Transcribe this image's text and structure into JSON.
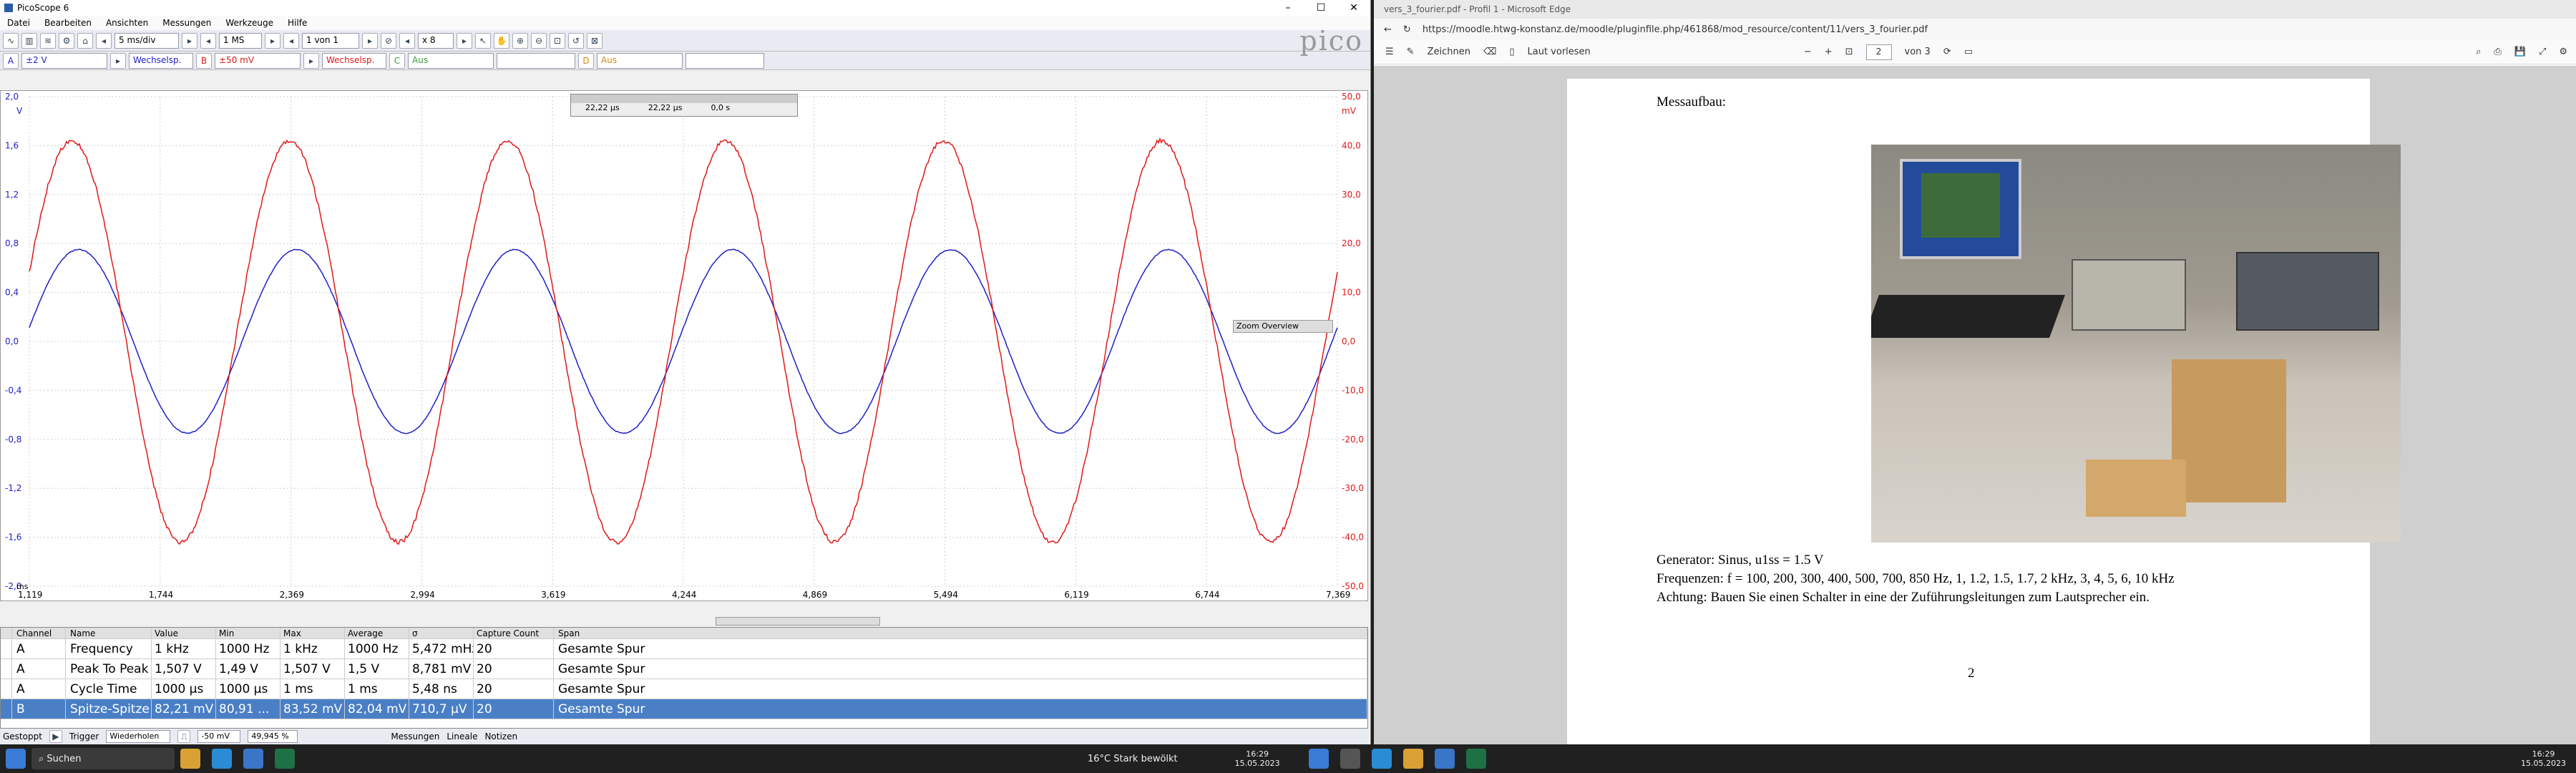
{
  "picoscope": {
    "title": "PicoScope 6",
    "menu": [
      "Datei",
      "Bearbeiten",
      "Ansichten",
      "Messungen",
      "Werkzeuge",
      "Hilfe"
    ],
    "timebase": "5 ms/div",
    "samples": "1 MS",
    "capture": "1 von 1",
    "zoom": "x 8",
    "chA_range": "±2 V",
    "chA_coupling": "Wechselsp.",
    "chB_range": "±50 mV",
    "chB_coupling": "Wechselsp.",
    "chC": "Aus",
    "chD": "Aus",
    "logo": "pico",
    "ruler_box": {
      "v1": "22,22 µs",
      "v2": "22,22 µs",
      "v3": "0,0 s"
    },
    "zoom_overview": "Zoom Overview",
    "left_axis": {
      "unit": "V",
      "ticks": [
        "2,0",
        "1,6",
        "1,2",
        "0,8",
        "0,4",
        "0,0",
        "-0,4",
        "-0,8",
        "-1,2",
        "-1,6",
        "-2,0"
      ]
    },
    "right_axis": {
      "unit": "mV",
      "ticks": [
        "50,0",
        "40,0",
        "30,0",
        "20,0",
        "10,0",
        "0,0",
        "-10,0",
        "-20,0",
        "-30,0",
        "-40,0",
        "-50,0"
      ]
    },
    "x_axis": {
      "unit": "ms",
      "ticks": [
        "1,119",
        "1,744",
        "2,369",
        "2,994",
        "3,619",
        "4,244",
        "4,869",
        "5,494",
        "6,119",
        "6,744",
        "7,369"
      ]
    },
    "colors": {
      "chA": "#2020c8",
      "chB": "#e01818"
    },
    "measurements": {
      "headers": [
        "Channel",
        "Name",
        "Value",
        "Min",
        "Max",
        "Average",
        "σ",
        "Capture Count",
        "Span"
      ],
      "rows": [
        [
          "A",
          "Frequency",
          "1 kHz",
          "1000 Hz",
          "1 kHz",
          "1000 Hz",
          "5,472 mHz",
          "20",
          "Gesamte Spur"
        ],
        [
          "A",
          "Peak To Peak",
          "1,507 V",
          "1,49 V",
          "1,507 V",
          "1,5 V",
          "8,781 mV",
          "20",
          "Gesamte Spur"
        ],
        [
          "A",
          "Cycle Time",
          "1000 µs",
          "1000 µs",
          "1 ms",
          "1 ms",
          "5,48 ns",
          "20",
          "Gesamte Spur"
        ],
        [
          "B",
          "Spitze-Spitze",
          "82,21 mV",
          "80,91 ...",
          "83,52 mV",
          "82,04 mV",
          "710,7 µV",
          "20",
          "Gesamte Spur"
        ]
      ]
    },
    "status": {
      "state": "Gestoppt",
      "trigger": "Trigger",
      "mode": "Wiederholen",
      "level": "-50 mV",
      "pct": "49,945 %",
      "meas": "Messungen",
      "rulers": "Lineale",
      "notes": "Notizen"
    }
  },
  "edge": {
    "tab_title": "vers_3_fourier.pdf - Profil 1 - Microsoft Edge",
    "url": "https://moodle.htwg-konstanz.de/moodle/pluginfile.php/461868/mod_resource/content/11/vers_3_fourier.pdf",
    "toolbar": {
      "draw": "Zeichnen",
      "read": "Laut vorlesen",
      "page": "2",
      "of": "von 3"
    },
    "pdf": {
      "heading": "Messaufbau:",
      "line1": "Generator: Sinus, u1ss = 1.5 V",
      "line2": "Frequenzen: f = 100, 200, 300, 400, 500, 700, 850 Hz, 1, 1.2, 1.5, 1.7, 2 kHz, 3, 4, 5, 6, 10 kHz",
      "line3": "Achtung: Bauen Sie einen Schalter in eine der Zuführungsleitungen zum Lautsprecher ein.",
      "pagenum": "2"
    }
  },
  "taskbar": {
    "search": "Suchen",
    "weather": "16°C  Stark bewölkt",
    "time_left": "16:29",
    "date_left": "15.05.2023",
    "time_right": "16:29",
    "date_right": "15.05.2023"
  }
}
